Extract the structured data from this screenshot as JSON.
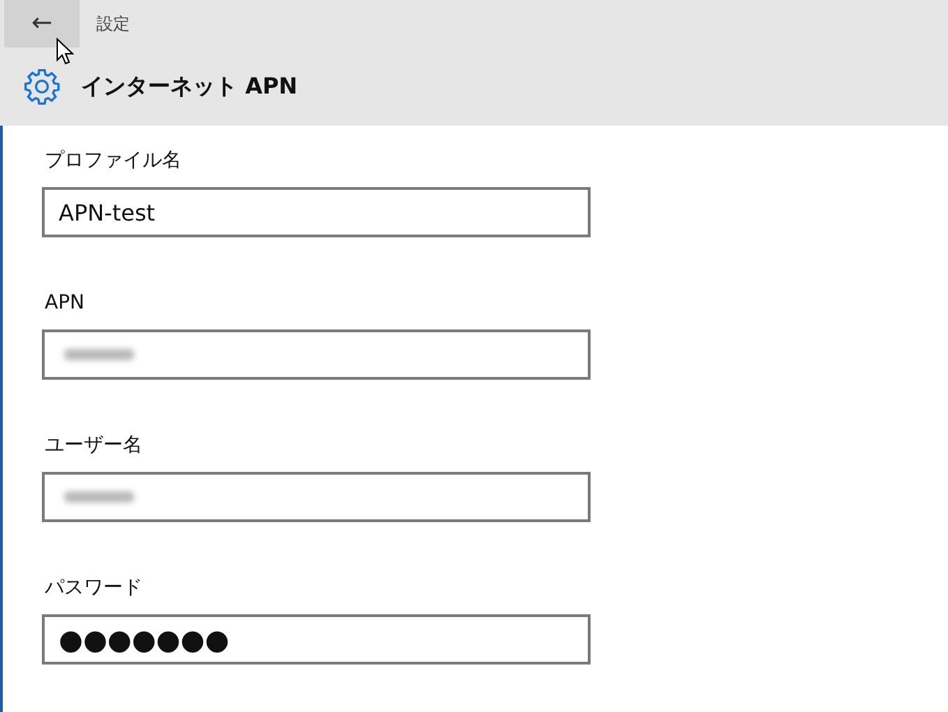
{
  "window": {
    "title": "設定",
    "back_button": {
      "label": "←",
      "hovered": true
    }
  },
  "header": {
    "title": "インターネット APN"
  },
  "fields": [
    {
      "kind": "text",
      "label": "プロファイル名",
      "value": "APN-test"
    },
    {
      "kind": "blurred",
      "label": "APN"
    },
    {
      "kind": "blurred",
      "label": "ユーザー名"
    },
    {
      "kind": "password",
      "label": "パスワード",
      "value": "●●●●●●●"
    }
  ]
}
